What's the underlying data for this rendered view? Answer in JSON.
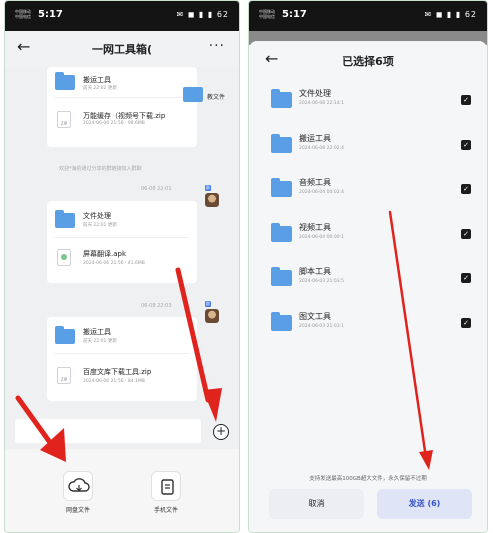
{
  "left": {
    "status": {
      "carrier_1": "中国移动",
      "carrier_2": "中国电信",
      "time": "5:17",
      "icons": "✉ ◼ ▮ ▮ 62"
    },
    "header": {
      "title": "一网工具箱(",
      "back_icon": "arrow-left-icon",
      "more_label": "···"
    },
    "floating_card": {
      "label": "教文件"
    },
    "cards": [
      {
        "folder_name": "搬运工具",
        "folder_meta": "前天 22:02 更新",
        "file_name": "万能缓存（视频号下载.zip",
        "file_meta": "2024-06-06 21:56 · 98.6MB",
        "file_type": "zip"
      },
      {
        "folder_name": "文件处理",
        "folder_meta": "前天 22:01 更新",
        "file_name": "屏幕翻译.apk",
        "file_meta": "2024-06-06 21:56 · 41.6MB",
        "file_type": "apk"
      },
      {
        "folder_name": "搬运工具",
        "folder_meta": "前天 22:01 更新",
        "file_name": "百度文库下载工具.zip",
        "file_meta": "2024-06-06 21:56 · 84.1MB",
        "file_type": "zip"
      }
    ],
    "system_message": "欢迎*海豹通过分享的群链接加入群聊",
    "timestamps": [
      "06-08 22:01",
      "06-08 22:03"
    ],
    "bottom_tools": [
      {
        "label": "网盘文件",
        "icon": "cloud-icon"
      },
      {
        "label": "手机文件",
        "icon": "document-icon"
      }
    ],
    "plus_icon": "plus-circle-icon"
  },
  "right": {
    "status": {
      "carrier_1": "中国移动",
      "carrier_2": "中国电信",
      "time": "5:17",
      "icons": "✉ ◼ ▮ ▮ 62"
    },
    "title": "已选择6项",
    "items": [
      {
        "name": "文件处理",
        "meta": "2024-06-08 22:14:1"
      },
      {
        "name": "搬运工具",
        "meta": "2024-06-08 22:02:4"
      },
      {
        "name": "音频工具",
        "meta": "2024-06-04 00:02:4"
      },
      {
        "name": "视频工具",
        "meta": "2024-06-04 00:00:1"
      },
      {
        "name": "脚本工具",
        "meta": "2024-06-03 21:03:5"
      },
      {
        "name": "图文工具",
        "meta": "2024-06-03 21:03:1"
      }
    ],
    "note": "支持发送最高100GB超大文件，永久保留不过期",
    "cancel_label": "取消",
    "send_label": "发送 (6)"
  },
  "colors": {
    "folder": "#5a9fe6",
    "arrow": "#e0231c",
    "send_text": "#3452c9",
    "status_bar": "#141414"
  }
}
